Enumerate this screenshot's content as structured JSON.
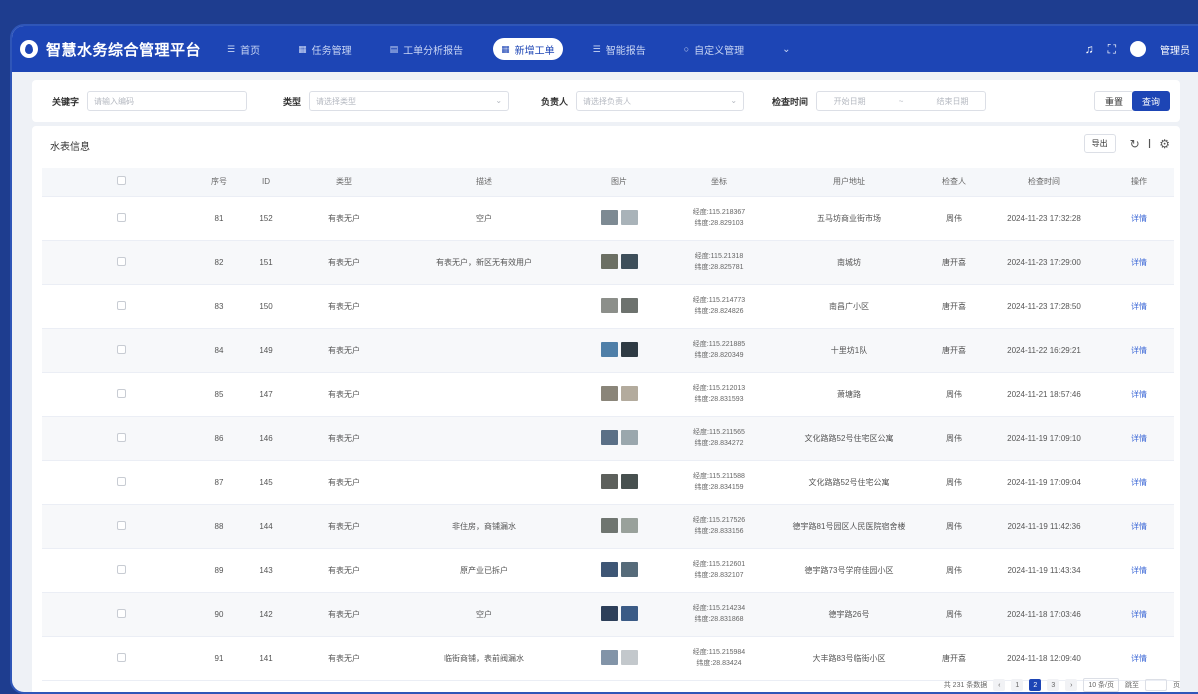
{
  "header": {
    "brand": "智慧水务综合管理平台",
    "nav": [
      {
        "label": "首页",
        "icon": "☰",
        "active": false
      },
      {
        "label": "任务管理",
        "icon": "▦",
        "active": false
      },
      {
        "label": "工单分析报告",
        "icon": "▤",
        "active": false
      },
      {
        "label": "新增工单",
        "icon": "▦",
        "active": true
      },
      {
        "label": "智能报告",
        "icon": "☰",
        "active": false
      },
      {
        "label": "自定义管理",
        "icon": "○",
        "active": false
      },
      {
        "label": "⌄",
        "icon": "",
        "active": false
      }
    ],
    "right_icons": [
      "bell-icon",
      "expand-icon"
    ],
    "user": "管理员"
  },
  "filters": {
    "keyword_label": "关键字",
    "keyword_placeholder": "请输入编码",
    "type_label": "类型",
    "type_placeholder": "请选择类型",
    "owner_label": "负责人",
    "owner_placeholder": "请选择负责人",
    "time_label": "检查时间",
    "start_placeholder": "开始日期",
    "time_sep": "~",
    "end_placeholder": "结束日期",
    "reset": "重置",
    "search": "查询"
  },
  "panel": {
    "title": "水表信息",
    "export": "导出"
  },
  "table": {
    "headers": [
      "序号",
      "ID",
      "类型",
      "描述",
      "图片",
      "坐标",
      "用户地址",
      "检查人",
      "检查时间",
      "操作"
    ],
    "rows": [
      {
        "seq": "81",
        "id": "152",
        "type": "有表无户",
        "desc": "空户",
        "lng": "经度:115.218367",
        "lat": "纬度:28.829103",
        "addr": "五马坊商业街市场",
        "inspector": "周伟",
        "time": "2024-11-23 17:32:28",
        "action": "详情"
      },
      {
        "seq": "82",
        "id": "151",
        "type": "有表无户",
        "desc": "有表无户，新区无有效用户",
        "lng": "经度:115.21318",
        "lat": "纬度:28.825781",
        "addr": "南城坊",
        "inspector": "唐开喜",
        "time": "2024-11-23 17:29:00",
        "action": "详情"
      },
      {
        "seq": "83",
        "id": "150",
        "type": "有表无户",
        "desc": "",
        "lng": "经度:115.214773",
        "lat": "纬度:28.824826",
        "addr": "南昌广小区",
        "inspector": "唐开喜",
        "time": "2024-11-23 17:28:50",
        "action": "详情"
      },
      {
        "seq": "84",
        "id": "149",
        "type": "有表无户",
        "desc": "",
        "lng": "经度:115.221885",
        "lat": "纬度:28.820349",
        "addr": "十里坊1队",
        "inspector": "唐开喜",
        "time": "2024-11-22 16:29:21",
        "action": "详情"
      },
      {
        "seq": "85",
        "id": "147",
        "type": "有表无户",
        "desc": "",
        "lng": "经度:115.212013",
        "lat": "纬度:28.831593",
        "addr": "萧塘路",
        "inspector": "周伟",
        "time": "2024-11-21 18:57:46",
        "action": "详情"
      },
      {
        "seq": "86",
        "id": "146",
        "type": "有表无户",
        "desc": "",
        "lng": "经度:115.211565",
        "lat": "纬度:28.834272",
        "addr": "文化路路52号住宅区公寓",
        "inspector": "周伟",
        "time": "2024-11-19 17:09:10",
        "action": "详情"
      },
      {
        "seq": "87",
        "id": "145",
        "type": "有表无户",
        "desc": "",
        "lng": "经度:115.211588",
        "lat": "纬度:28.834159",
        "addr": "文化路路52号住宅公寓",
        "inspector": "周伟",
        "time": "2024-11-19 17:09:04",
        "action": "详情"
      },
      {
        "seq": "88",
        "id": "144",
        "type": "有表无户",
        "desc": "非住房，商铺漏水",
        "lng": "经度:115.217526",
        "lat": "纬度:28.833156",
        "addr": "德宇路81号园区人民医院宿舍楼",
        "inspector": "周伟",
        "time": "2024-11-19 11:42:36",
        "action": "详情"
      },
      {
        "seq": "89",
        "id": "143",
        "type": "有表无户",
        "desc": "原产业已拆户",
        "lng": "经度:115.212601",
        "lat": "纬度:28.832107",
        "addr": "德宇路73号学府佳园小区",
        "inspector": "周伟",
        "time": "2024-11-19 11:43:34",
        "action": "详情"
      },
      {
        "seq": "90",
        "id": "142",
        "type": "有表无户",
        "desc": "空户",
        "lng": "经度:115.214234",
        "lat": "纬度:28.831868",
        "addr": "德宇路26号",
        "inspector": "周伟",
        "time": "2024-11-18 17:03:46",
        "action": "详情"
      },
      {
        "seq": "91",
        "id": "141",
        "type": "有表无户",
        "desc": "临街商铺，表前阀漏水",
        "lng": "经度:115.215984",
        "lat": "纬度:28.83424",
        "addr": "大丰路83号临街小区",
        "inspector": "唐开喜",
        "time": "2024-11-18 12:09:40",
        "action": "详情"
      }
    ]
  },
  "pagination": {
    "total": "共 231 条数据",
    "prev": "‹",
    "pages": [
      "1",
      "2",
      "3"
    ],
    "current": "2",
    "next": "›",
    "page_size": "10 条/页",
    "goto": "跳至",
    "page_unit": "页"
  }
}
